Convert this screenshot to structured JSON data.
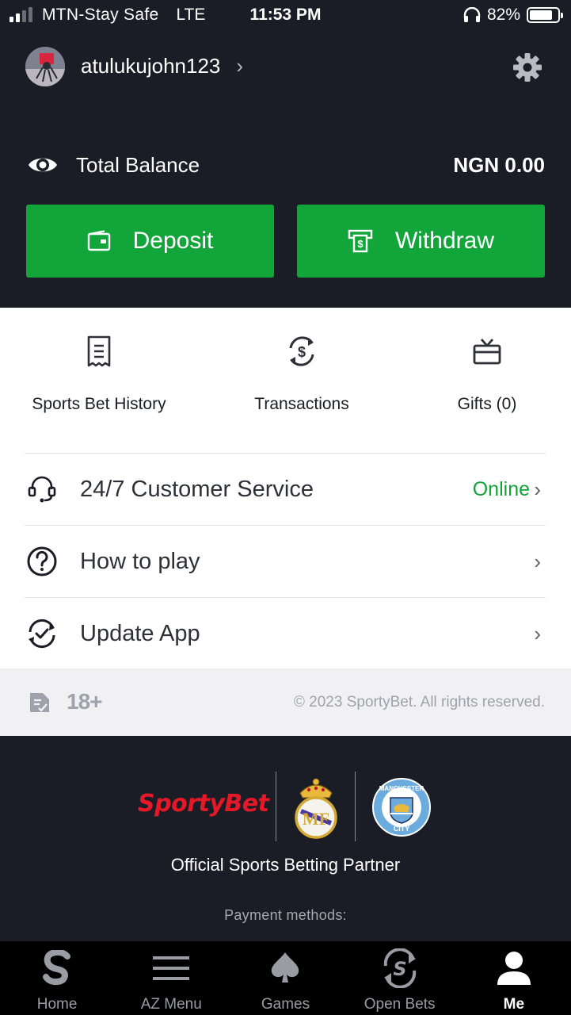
{
  "status_bar": {
    "carrier": "MTN-Stay Safe",
    "network": "LTE",
    "time": "11:53 PM",
    "battery_percent": "82%",
    "battery_level": 0.82,
    "signal_bars": 2,
    "signal_total": 4,
    "headphones_icon": "headphones-icon"
  },
  "account": {
    "username": "atulukujohn123",
    "settings_icon": "gear-icon",
    "balance_label": "Total Balance",
    "balance_amount": "NGN 0.00",
    "deposit_label": "Deposit",
    "withdraw_label": "Withdraw"
  },
  "quick_actions": [
    {
      "label": "Sports Bet History",
      "icon": "receipt-icon"
    },
    {
      "label": "Transactions",
      "icon": "currency-exchange-icon"
    },
    {
      "label": "Gifts (0)",
      "icon": "gift-icon"
    }
  ],
  "menu": [
    {
      "label": "24/7 Customer Service",
      "status": "Online",
      "icon": "headset-icon"
    },
    {
      "label": "How to play",
      "status": "",
      "icon": "question-icon"
    },
    {
      "label": "Update App",
      "status": "",
      "icon": "update-icon"
    }
  ],
  "notice": {
    "age_limit": "18+",
    "copyright": "© 2023 SportyBet. All rights reserved."
  },
  "partners": {
    "brand": "SportyBet",
    "tagline": "Official Sports Betting Partner",
    "payment_label": "Payment methods:",
    "manchester_text": "MANCHESTER",
    "city_text": "CITY"
  },
  "tabs": [
    {
      "label": "Home",
      "icon": "sporty-s-icon",
      "active": false
    },
    {
      "label": "AZ Menu",
      "icon": "hamburger-icon",
      "active": false
    },
    {
      "label": "Games",
      "icon": "spade-icon",
      "active": false
    },
    {
      "label": "Open Bets",
      "icon": "open-bets-icon",
      "active": false
    },
    {
      "label": "Me",
      "icon": "person-icon",
      "active": true
    }
  ],
  "colors": {
    "background_dark": "#1b1d26",
    "accent_green": "#12a63a",
    "online_green": "#11a537",
    "brand_red": "#e41827"
  }
}
